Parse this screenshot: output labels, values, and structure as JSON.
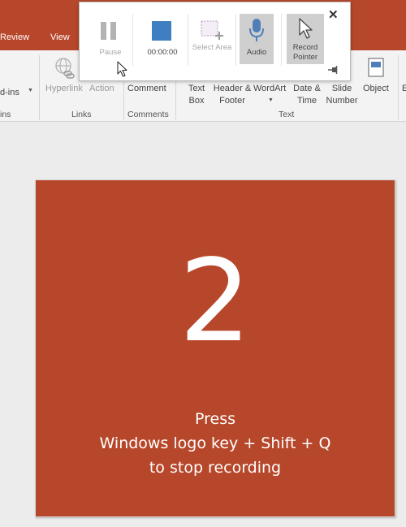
{
  "tabs": {
    "review": "Review",
    "view": "View"
  },
  "ribbon": {
    "addins_label": "d-ins",
    "addins_group": "ins",
    "hyperlink": "Hyperlink",
    "action": "Action",
    "links_group": "Links",
    "comment": "Comment",
    "comments_group": "Comments",
    "text_box": "Text Box",
    "header_footer": "Header & Footer",
    "wordart": "WordArt",
    "date_time": "Date & Time",
    "slide_number": "Slide Number",
    "object": "Object",
    "eqn": "E",
    "text_group": "Text"
  },
  "recorder": {
    "pause": "Pause",
    "timer": "00:00:00",
    "select_area": "Select Area",
    "audio": "Audio",
    "record_pointer": "Record Pointer",
    "close": "✕"
  },
  "slide": {
    "countdown": "2",
    "line1": "Press",
    "line2": "Windows logo key + Shift + Q",
    "line3": "to stop recording"
  },
  "colors": {
    "accent": "#b7472a",
    "stop_button": "#3f7ec0",
    "mic": "#4f7fb8"
  }
}
